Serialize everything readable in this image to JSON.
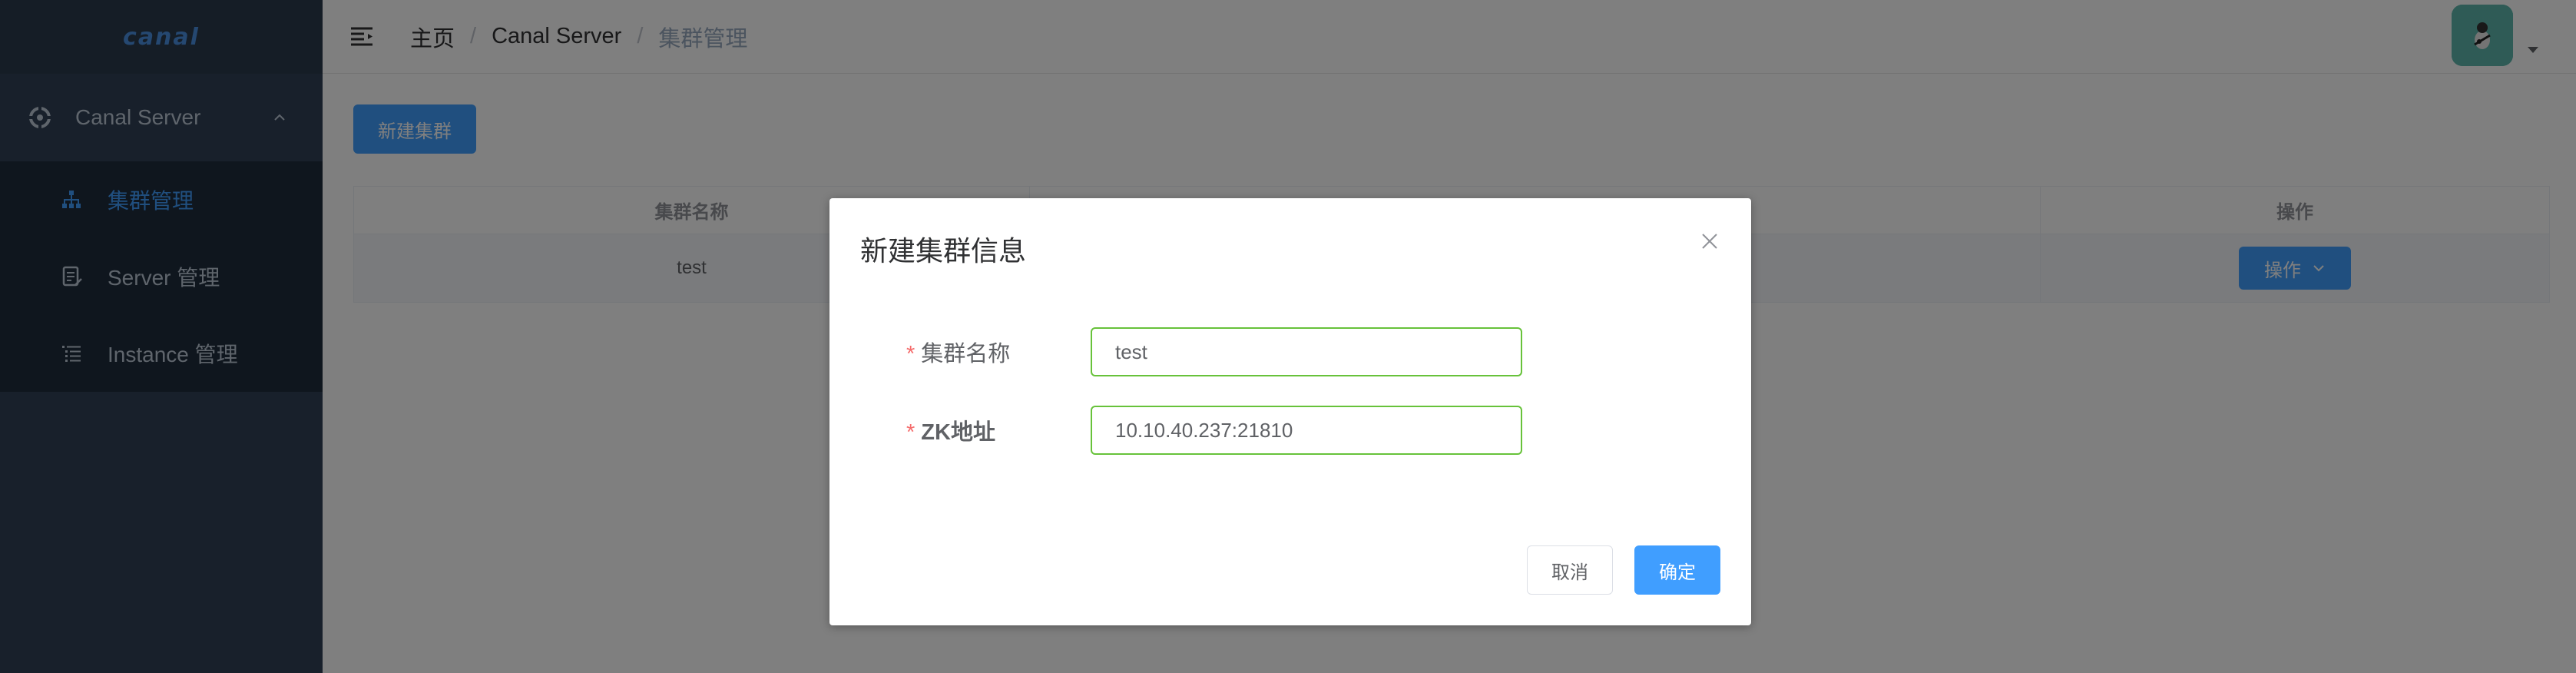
{
  "sidebar": {
    "logo": "canal",
    "group": {
      "label": "Canal Server",
      "icon": "settings-icon",
      "expanded": true
    },
    "items": [
      {
        "label": "集群管理",
        "icon": "cluster-tree-icon",
        "active": true
      },
      {
        "label": "Server 管理",
        "icon": "server-doc-icon",
        "active": false
      },
      {
        "label": "Instance 管理",
        "icon": "list-icon",
        "active": false
      }
    ]
  },
  "header": {
    "breadcrumb": [
      "主页",
      "Canal Server",
      "集群管理"
    ],
    "separator": "/",
    "avatar_icon": "user-avatar-icon"
  },
  "main": {
    "new_button_label": "新建集群",
    "table": {
      "columns": [
        "集群名称",
        "",
        "操作"
      ],
      "rows": [
        {
          "name": "test",
          "zk": "",
          "action_label": "操作"
        }
      ]
    }
  },
  "dialog": {
    "title": "新建集群信息",
    "required_mark": "*",
    "fields": [
      {
        "label": "集群名称",
        "value": "test",
        "placeholder": ""
      },
      {
        "label": "ZK地址",
        "value": "10.10.40.237:21810",
        "placeholder": ""
      }
    ],
    "cancel_label": "取消",
    "ok_label": "确定"
  },
  "colors": {
    "sidebar_bg": "#304156",
    "submenu_bg": "#1f2d3d",
    "primary": "#409eff",
    "valid_border": "#67c23a",
    "required": "#f56c6c"
  }
}
